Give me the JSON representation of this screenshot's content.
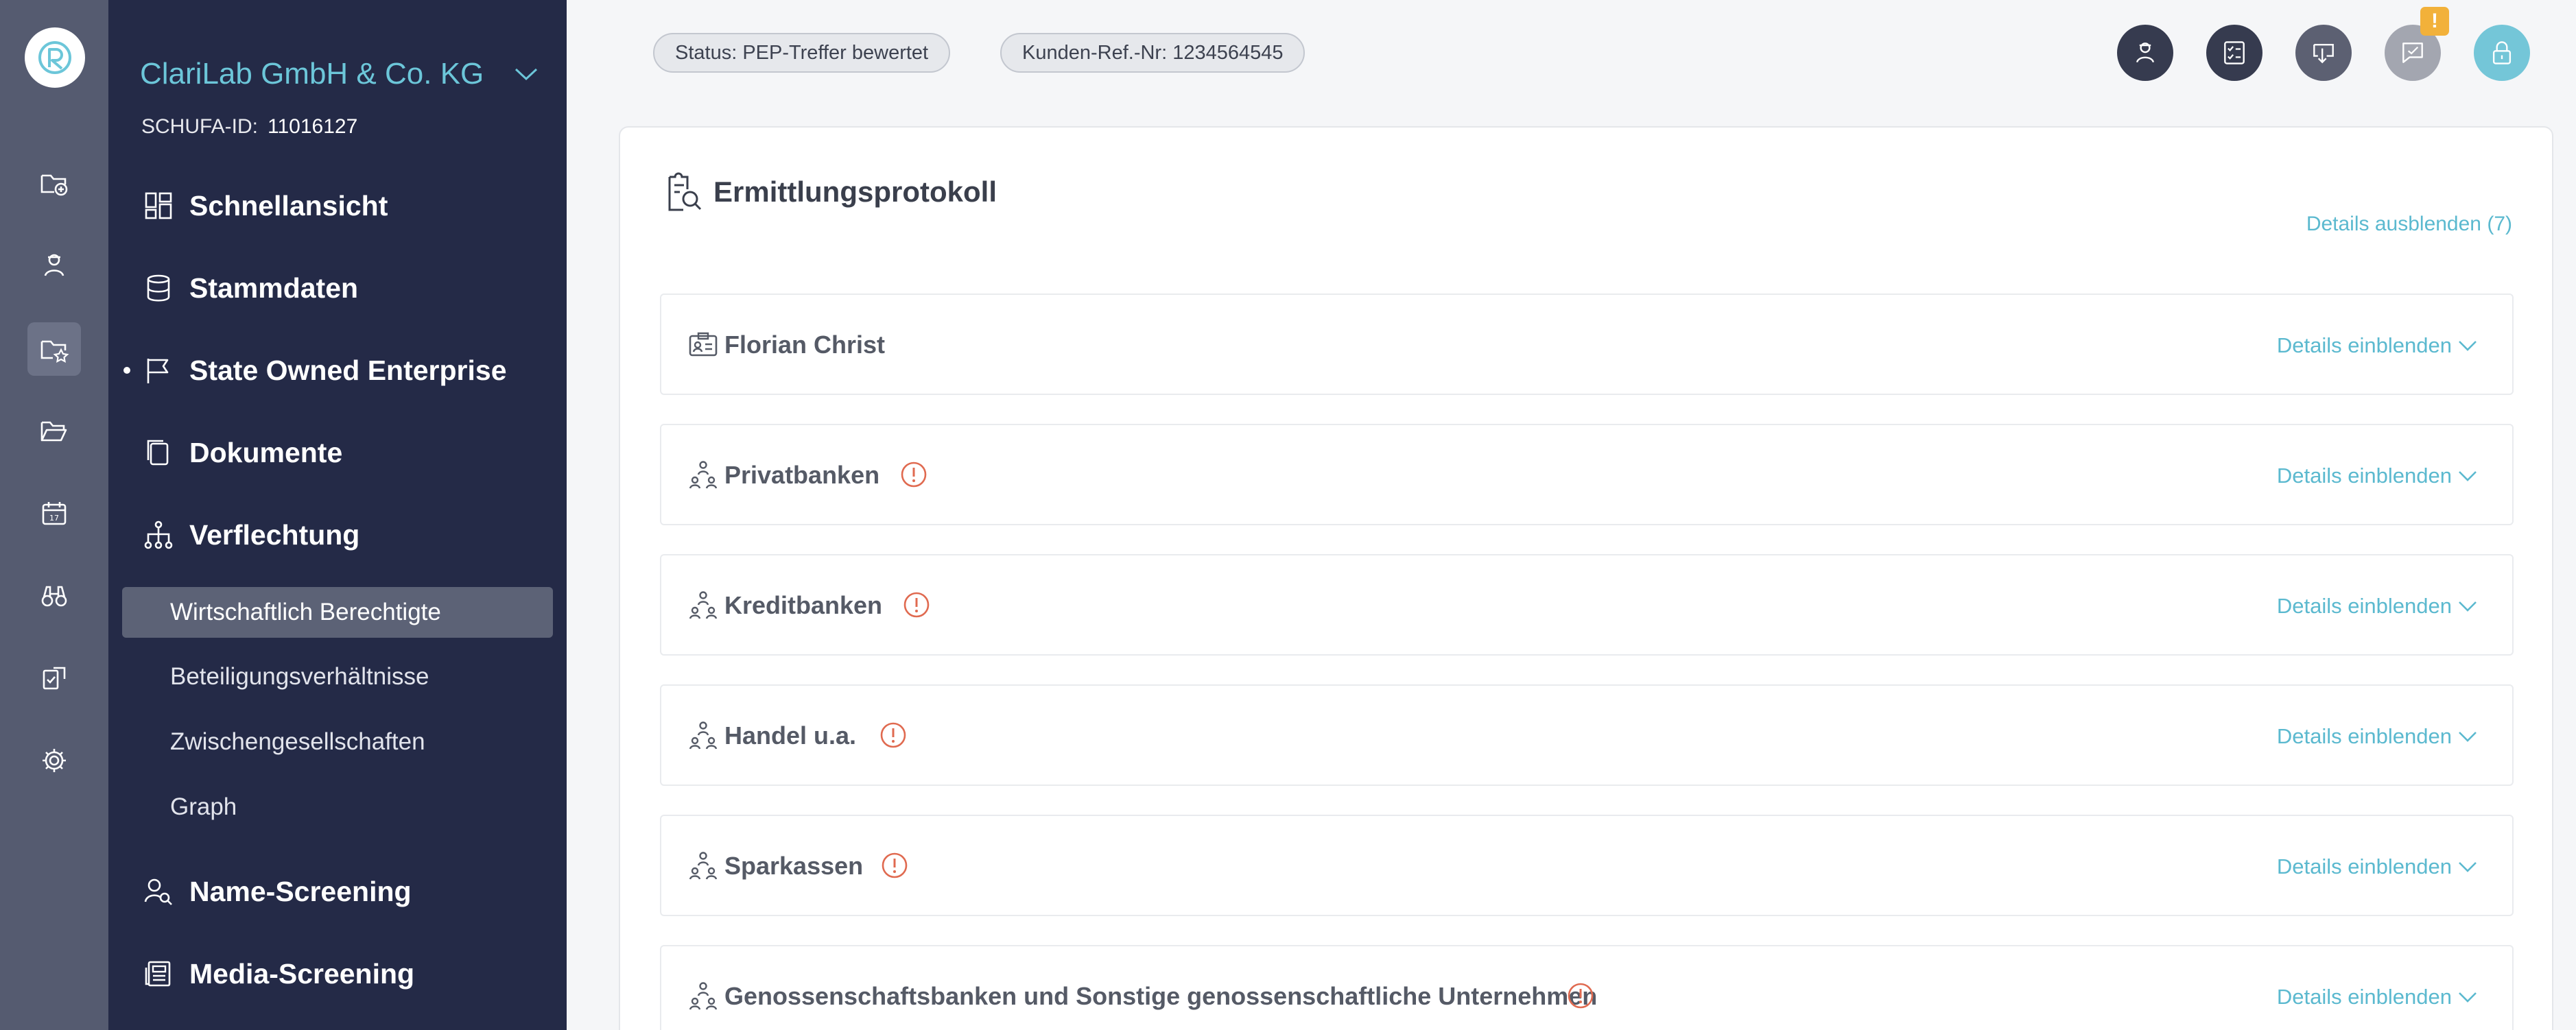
{
  "sidebar": {
    "company_name": "ClariLab GmbH & Co. KG",
    "schufa_label": "SCHUFA-ID:",
    "schufa_value": "11016127",
    "nav": {
      "schnellansicht": "Schnellansicht",
      "stammdaten": "Stammdaten",
      "soe": "State Owned Enterprise",
      "dokumente": "Dokumente",
      "verflechtung": "Verflechtung",
      "name_screening": "Name-Screening",
      "media_screening": "Media-Screening"
    },
    "sub": {
      "wirtschaftlich": "Wirtschaftlich Berechtigte",
      "beteiligung": "Beteiligungsverhältnisse",
      "zwischen": "Zwischengesellschaften",
      "graph": "Graph"
    }
  },
  "header": {
    "status_pill": "Status: PEP-Treffer bewertet",
    "ref_pill": "Kunden-Ref.-Nr: 1234564545",
    "notification_badge": "!",
    "icons": [
      "person-icon",
      "checklist-icon",
      "download-icon",
      "comment-icon",
      "lock-icon"
    ]
  },
  "colors": {
    "accent": "#5bb9cf",
    "sidebar_bg": "#242a47",
    "rail_bg": "#555b70",
    "warning": "#e06a50",
    "badge": "#f2b13a"
  },
  "protocol": {
    "title": "Ermittlungsprotokoll",
    "toggle_all": "Details ausblenden (7)",
    "rows": [
      {
        "label": "Florian Christ",
        "details": "Details einblenden"
      },
      {
        "label": "Privatbanken",
        "details": "Details einblenden"
      },
      {
        "label": "Kreditbanken",
        "details": "Details einblenden"
      },
      {
        "label": "Handel u.a.",
        "details": "Details einblenden"
      },
      {
        "label": "Sparkassen",
        "details": "Details einblenden"
      },
      {
        "label": "Genossenschaftsbanken und Sonstige genossenschaftliche Unternehmen",
        "details": "Details einblenden"
      }
    ]
  }
}
